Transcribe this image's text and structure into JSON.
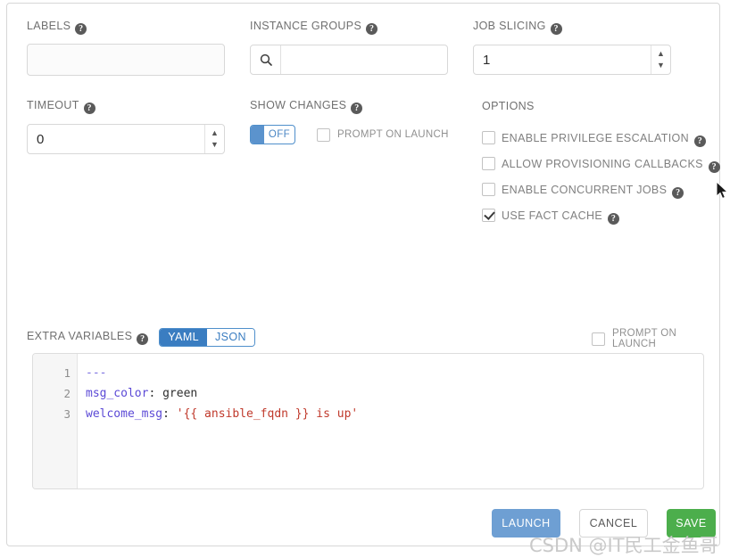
{
  "fields": {
    "labels": {
      "label": "LABELS",
      "help": "?",
      "value": "",
      "placeholder": ""
    },
    "instance_groups": {
      "label": "INSTANCE GROUPS",
      "help": "?",
      "value": "",
      "placeholder": "",
      "icon": "search-icon"
    },
    "job_slicing": {
      "label": "JOB SLICING",
      "help": "?",
      "value": "1"
    },
    "timeout": {
      "label": "TIMEOUT",
      "help": "?",
      "value": "0"
    },
    "show_changes": {
      "label": "SHOW CHANGES",
      "help": "?",
      "toggle_state": "OFF",
      "prompt_on_launch": "PROMPT ON LAUNCH",
      "prompt_checked": false
    }
  },
  "options": {
    "title": "OPTIONS",
    "items": [
      {
        "label": "ENABLE PRIVILEGE ESCALATION",
        "checked": false,
        "help": "?"
      },
      {
        "label": "ALLOW PROVISIONING CALLBACKS",
        "checked": false,
        "help": "?"
      },
      {
        "label": "ENABLE CONCURRENT JOBS",
        "checked": false,
        "help": "?"
      },
      {
        "label": "USE FACT CACHE",
        "checked": true,
        "help": "?"
      }
    ]
  },
  "extra_variables": {
    "label": "EXTRA VARIABLES",
    "help": "?",
    "format_yaml": "YAML",
    "format_json": "JSON",
    "selected_format": "YAML",
    "prompt_on_launch": "PROMPT ON LAUNCH",
    "prompt_checked": false,
    "line_numbers": [
      "1",
      "2",
      "3"
    ],
    "lines": [
      {
        "dash": "---"
      },
      {
        "key": "msg_color",
        "colon": ":",
        "value": " green"
      },
      {
        "key": "welcome_msg",
        "colon": ":",
        "string": " '{{ ansible_fqdn }} is up'"
      }
    ]
  },
  "footer": {
    "launch": "LAUNCH",
    "cancel": "CANCEL",
    "save": "SAVE"
  },
  "watermark": "CSDN @IT民工金鱼哥",
  "colors": {
    "accent_blue": "#3a7dc1",
    "launch_blue": "#6e9fd3",
    "save_green": "#4cae4c",
    "label_gray": "#707070"
  }
}
